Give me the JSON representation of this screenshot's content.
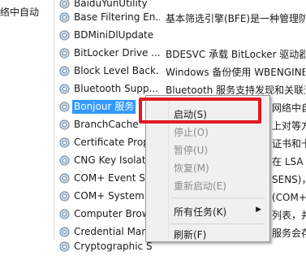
{
  "left_pane": {
    "text": "络中自动"
  },
  "services": [
    {
      "name": "BaiduYunUtility",
      "desc": ""
    },
    {
      "name": "Base Filtering En...",
      "desc": "基本筛选引擎(BFE)是一种管理防"
    },
    {
      "name": "BDMiniDlUpdate",
      "desc": ""
    },
    {
      "name": "BitLocker Drive ...",
      "desc": "BDESVC 承载 BitLocker 驱动器"
    },
    {
      "name": "Block Level Back...",
      "desc": "Windows 备份使用 WBENGINE"
    },
    {
      "name": "Bluetooth Supp...",
      "desc": "Bluetooth 服务支持发现和关联远"
    },
    {
      "name": "Bonjour 服务",
      "desc": "网络中自"
    },
    {
      "name": "BranchCache",
      "desc": "上对等方"
    },
    {
      "name": "Certificate Prop",
      "desc": "证书和卡复制"
    },
    {
      "name": "CNG Key Isolati",
      "desc": "在 LSA 进"
    },
    {
      "name": "COM+ Event Sy",
      "desc": "SENS)，"
    },
    {
      "name": "COM+ System",
      "desc": "(COM+) 的"
    },
    {
      "name": "Computer Brow",
      "desc": "列表，并"
    },
    {
      "name": "Credential Man",
      "desc": "服务会存"
    },
    {
      "name": "Cryptographic S",
      "desc": ""
    }
  ],
  "context_menu": {
    "items": [
      {
        "label": "启动(S)",
        "disabled": false
      },
      {
        "label": "停止(O)",
        "disabled": true
      },
      {
        "label": "暂停(U)",
        "disabled": true
      },
      {
        "label": "恢复(M)",
        "disabled": true
      },
      {
        "label": "重新启动(E)",
        "disabled": true
      },
      {
        "label": "所有任务(K)",
        "disabled": false,
        "arrow": "▶"
      },
      {
        "label": "刷新(F)",
        "disabled": false
      }
    ]
  },
  "colors": {
    "selection": "#3399ff",
    "highlight_box": "#e21a22"
  }
}
